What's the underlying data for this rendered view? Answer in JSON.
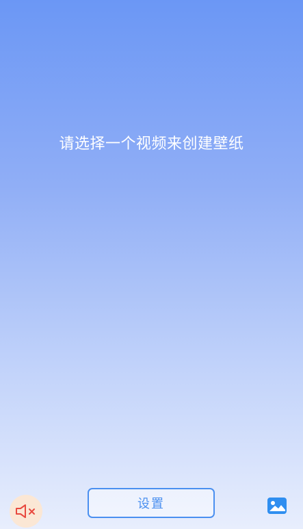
{
  "prompt": {
    "text": "请选择一个视频来创建壁纸"
  },
  "bottom_bar": {
    "mute_icon": "speaker-muted-icon",
    "settings_label": "设置",
    "wallpaper_icon": "image-icon"
  },
  "colors": {
    "gradient_top": "#6b97f5",
    "gradient_bottom": "#e8eefd",
    "accent_blue": "#4a8ff0",
    "mute_bg": "#fbe7d5",
    "mute_red": "#e8493f"
  }
}
